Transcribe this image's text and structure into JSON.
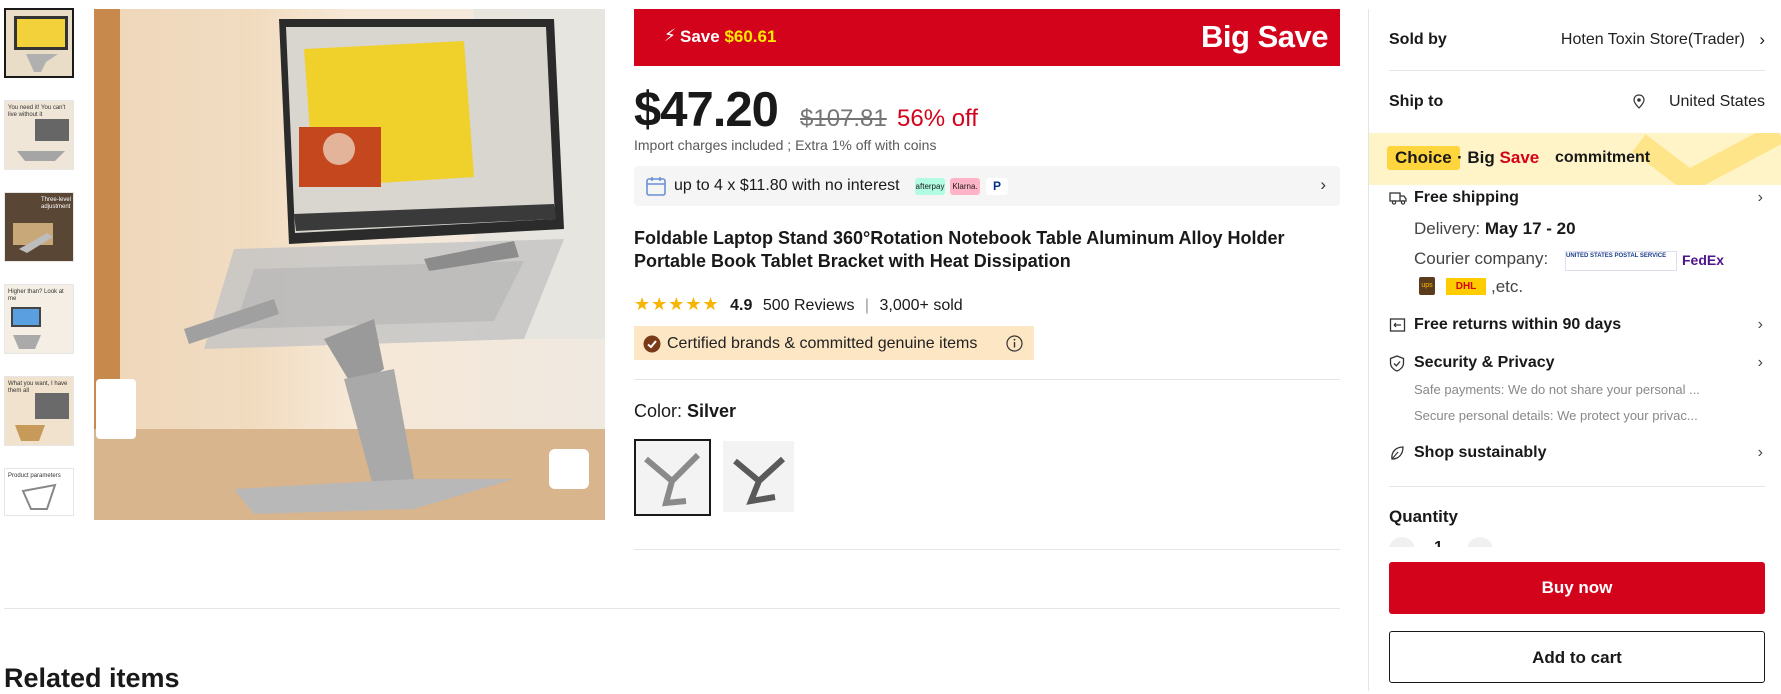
{
  "thumbnails": [
    {
      "caption": ""
    },
    {
      "caption": "You need it! You can't live without it"
    },
    {
      "caption": "Three-level Display adjustment"
    },
    {
      "caption": "Higher than? Look at me"
    },
    {
      "caption": "What you want, I have them all"
    },
    {
      "caption": "Product parameters"
    }
  ],
  "banner": {
    "save_prefix": "Save",
    "save_amount": "$60.61",
    "brand": "Big Save"
  },
  "price": {
    "current": "$47.20",
    "original": "$107.81",
    "discount": "56% off",
    "import_note": "Import charges included ; Extra 1% off with coins"
  },
  "installments": {
    "text": "up to 4 x $11.80 with no interest",
    "badges": [
      "afterpay",
      "Klarna.",
      "P"
    ]
  },
  "product": {
    "title": "Foldable Laptop Stand 360°Rotation Notebook Table Aluminum Alloy Holder Portable Book Tablet Bracket with Heat Dissipation",
    "rating": "4.9",
    "rating_value": 4.9,
    "reviews": "500 Reviews",
    "sold": "3,000+ sold",
    "certified": "Certified brands & committed genuine items"
  },
  "color": {
    "label": "Color:",
    "selected": "Silver"
  },
  "related_title": "Related items",
  "sidebar": {
    "sold_by_label": "Sold by",
    "sold_by_value": "Hoten Toxin Store(Trader)",
    "ship_to_label": "Ship to",
    "ship_to_value": "United States",
    "choice": {
      "tag": "Choice",
      "dot": "·",
      "big": "Big",
      "save": "Save",
      "commitment": "commitment"
    },
    "free_shipping": "Free shipping",
    "delivery_label": "Delivery:",
    "delivery_value": "May 17 - 20",
    "courier_label": "Courier company:",
    "courier_usps": "UNITED STATES POSTAL SERVICE",
    "courier_fedex": "FedEx",
    "courier_ups": "ups",
    "courier_dhl": "DHL",
    "courier_etc": ",etc.",
    "free_returns": "Free returns within 90 days",
    "security": "Security & Privacy",
    "security_sub1": "Safe payments: We do not share your personal ...",
    "security_sub2": "Secure personal details: We protect your privac...",
    "sustainably": "Shop sustainably",
    "quantity_label": "Quantity",
    "quantity_value": "1",
    "buy_now": "Buy now",
    "add_to_cart": "Add to cart"
  },
  "colors": {
    "accent": "#d3031c",
    "yellow": "#ffe900",
    "choice": "#ffd53d",
    "star": "#f7b400"
  }
}
